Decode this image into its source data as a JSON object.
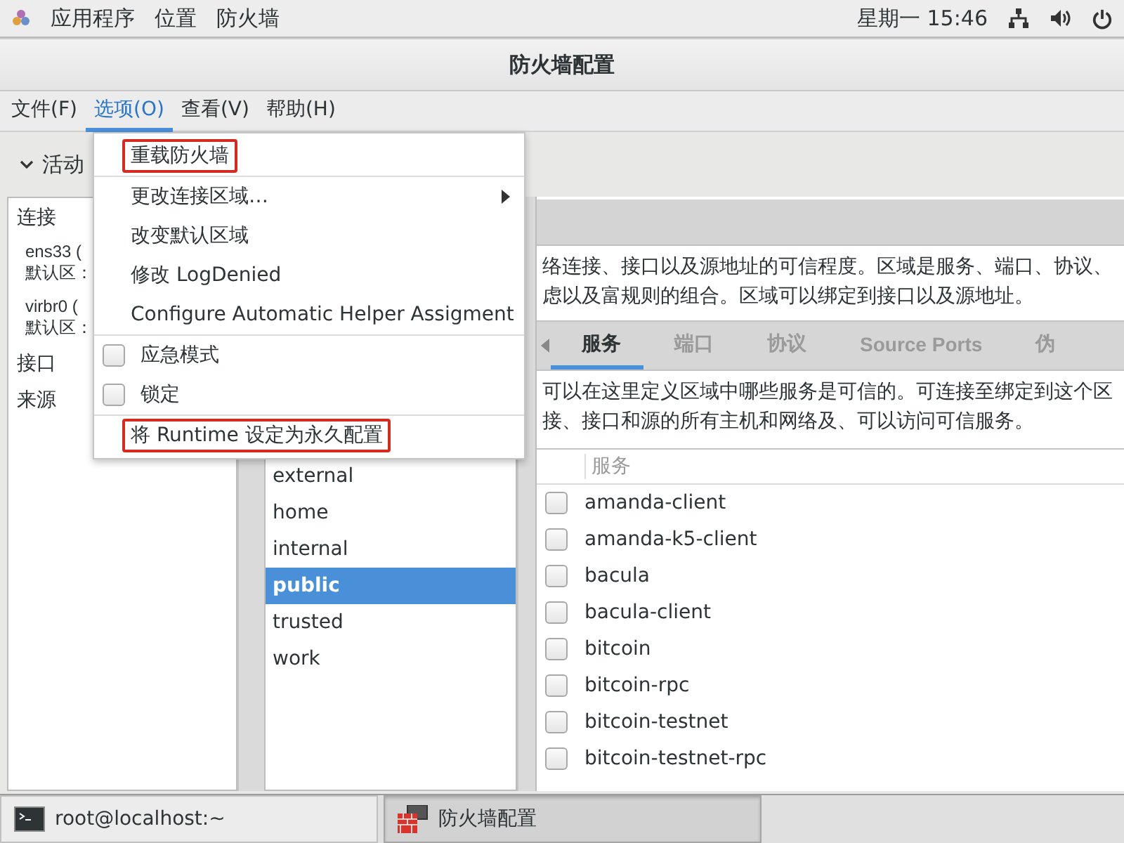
{
  "top_bar": {
    "menus": [
      "应用程序",
      "位置",
      "防火墙"
    ],
    "clock": "星期一 15:46"
  },
  "window": {
    "title": "防火墙配置"
  },
  "menu_bar": [
    {
      "label": "文件(F)",
      "selected": false
    },
    {
      "label": "选项(O)",
      "selected": true
    },
    {
      "label": "查看(V)",
      "selected": false
    },
    {
      "label": "帮助(H)",
      "selected": false
    }
  ],
  "active_bindings": {
    "label": "活动",
    "expanded": true
  },
  "connections": {
    "heading": "连接",
    "items": [
      {
        "name": "ens33 (",
        "zone": "默认区："
      },
      {
        "name": "virbr0 (",
        "zone": "默认区："
      }
    ],
    "sections": [
      "接口",
      "来源"
    ]
  },
  "options_menu": [
    {
      "kind": "item",
      "label": "重载防火墙",
      "highlighted": true,
      "submenu": false,
      "separator_after": true
    },
    {
      "kind": "item",
      "label": "更改连接区域…",
      "highlighted": false,
      "submenu": true,
      "separator_after": false
    },
    {
      "kind": "item",
      "label": "改变默认区域",
      "highlighted": false,
      "submenu": false,
      "separator_after": false
    },
    {
      "kind": "item",
      "label": "修改 LogDenied",
      "highlighted": false,
      "submenu": false,
      "separator_after": false
    },
    {
      "kind": "item",
      "label": "Configure Automatic Helper Assigment",
      "highlighted": false,
      "submenu": false,
      "separator_after": true
    },
    {
      "kind": "check",
      "label": "应急模式",
      "checked": false,
      "highlighted": false,
      "separator_after": false
    },
    {
      "kind": "check",
      "label": "锁定",
      "checked": false,
      "highlighted": false,
      "separator_after": true
    },
    {
      "kind": "item",
      "label": "将 Runtime 设定为永久配置",
      "highlighted": true,
      "submenu": false,
      "separator_after": false
    }
  ],
  "zones": [
    {
      "name": "external",
      "selected": false
    },
    {
      "name": "home",
      "selected": false
    },
    {
      "name": "internal",
      "selected": false
    },
    {
      "name": "public",
      "selected": true
    },
    {
      "name": "trusted",
      "selected": false
    },
    {
      "name": "work",
      "selected": false
    }
  ],
  "zone_description": [
    "络连接、接口以及源地址的可信程度。区域是服务、端口、协议、",
    "虑以及富规则的组合。区域可以绑定到接口以及源地址。"
  ],
  "tabs": [
    {
      "label": "服务",
      "selected": true
    },
    {
      "label": "端口",
      "selected": false
    },
    {
      "label": "协议",
      "selected": false
    },
    {
      "label": "Source Ports",
      "selected": false
    },
    {
      "label": "伪",
      "selected": false
    }
  ],
  "tab_description": [
    "可以在这里定义区域中哪些服务是可信的。可连接至绑定到这个区",
    "接、接口和源的所有主机和网络及、可以访问可信服务。"
  ],
  "services_table": {
    "column": "服务",
    "rows": [
      {
        "name": "amanda-client",
        "checked": false
      },
      {
        "name": "amanda-k5-client",
        "checked": false
      },
      {
        "name": "bacula",
        "checked": false
      },
      {
        "name": "bacula-client",
        "checked": false
      },
      {
        "name": "bitcoin",
        "checked": false
      },
      {
        "name": "bitcoin-rpc",
        "checked": false
      },
      {
        "name": "bitcoin-testnet",
        "checked": false
      },
      {
        "name": "bitcoin-testnet-rpc",
        "checked": false
      }
    ]
  },
  "taskbar": [
    {
      "kind": "terminal",
      "label": "root@localhost:~",
      "selected": false
    },
    {
      "kind": "firewall",
      "label": "防火墙配置",
      "selected": true
    }
  ]
}
